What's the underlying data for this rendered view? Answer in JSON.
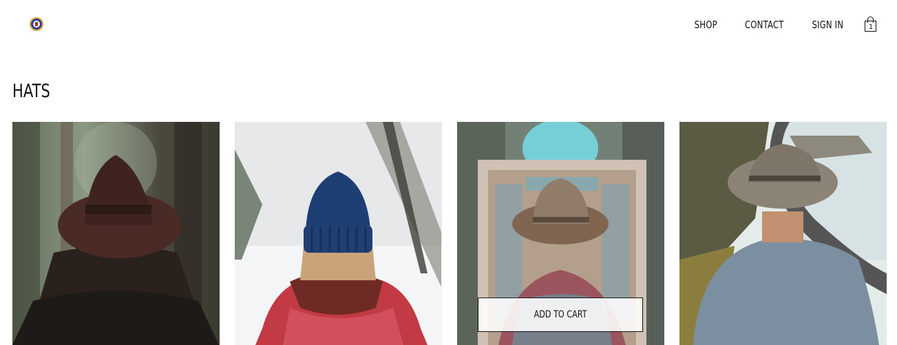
{
  "header": {
    "logo_icon": "crest-logo-icon",
    "nav": [
      {
        "label": "SHOP"
      },
      {
        "label": "CONTACT"
      },
      {
        "label": "SIGN IN"
      }
    ],
    "cart": {
      "icon": "shopping-bag-icon",
      "count": "1"
    }
  },
  "collection": {
    "title": "HATS",
    "items": [
      {
        "image": "brown-fedora-forest",
        "hovered": false
      },
      {
        "image": "blue-beanie-snow",
        "hovered": false
      },
      {
        "image": "cowboy-hat-mosque",
        "hovered": true,
        "button_label": "ADD TO CART"
      },
      {
        "image": "grey-wide-brim-coast",
        "hovered": false
      }
    ]
  }
}
